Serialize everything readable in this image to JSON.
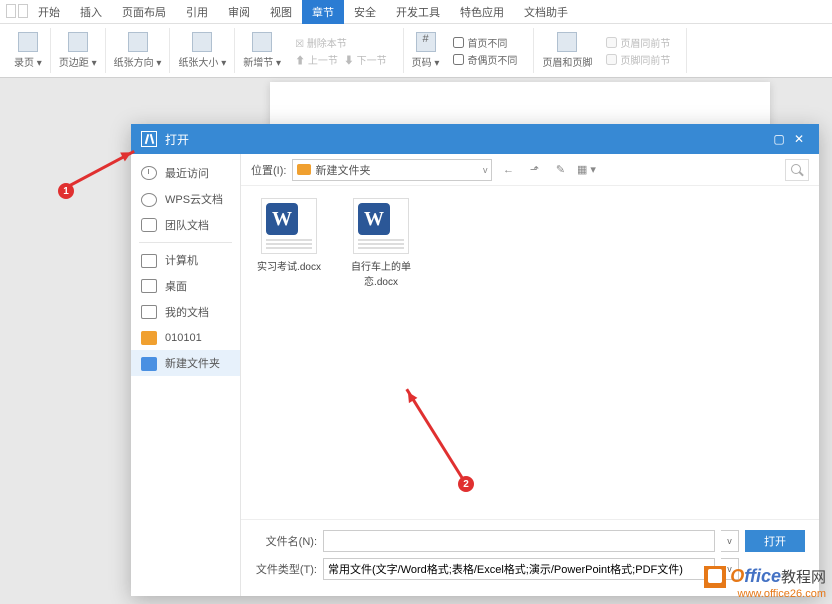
{
  "ribbon_tabs": {
    "start": "开始",
    "insert": "插入",
    "layout": "页面布局",
    "ref": "引用",
    "review": "审阅",
    "view": "视图",
    "chapter": "章节",
    "security": "安全",
    "dev": "开发工具",
    "special": "特色应用",
    "helper": "文档助手"
  },
  "ribbon": {
    "toc": "录页",
    "margin": "页边距",
    "orient": "纸张方向",
    "size": "纸张大小",
    "addsec": "新增节",
    "delsec": "删除本节",
    "prevsec": "上一节",
    "nextsec": "下一节",
    "pagenum": "页码",
    "firstdiff": "首页不同",
    "oddeven": "奇偶页不同",
    "headerfooter": "页眉和页脚",
    "sameheader": "页眉同前节",
    "samefooter": "页脚同前节"
  },
  "dialog": {
    "title": "打开",
    "location_label": "位置(I):",
    "current_folder": "新建文件夹",
    "filename_label": "文件名(N):",
    "filetype_label": "文件类型(T):",
    "filetype_value": "常用文件(文字/Word格式;表格/Excel格式;演示/PowerPoint格式;PDF文件)",
    "open_btn": "打开"
  },
  "sidebar": {
    "recent": "最近访问",
    "cloud": "WPS云文档",
    "team": "团队文档",
    "computer": "计算机",
    "desktop": "桌面",
    "mydocs": "我的文档",
    "folder1": "010101",
    "folder2": "新建文件夹"
  },
  "files": {
    "f1": "实习考试.docx",
    "f2": "自行车上的单恋.docx"
  },
  "markers": {
    "m1": "1",
    "m2": "2"
  },
  "watermark": {
    "brand": "Office",
    "suffix": "教程网",
    "url": "www.office26.com"
  }
}
